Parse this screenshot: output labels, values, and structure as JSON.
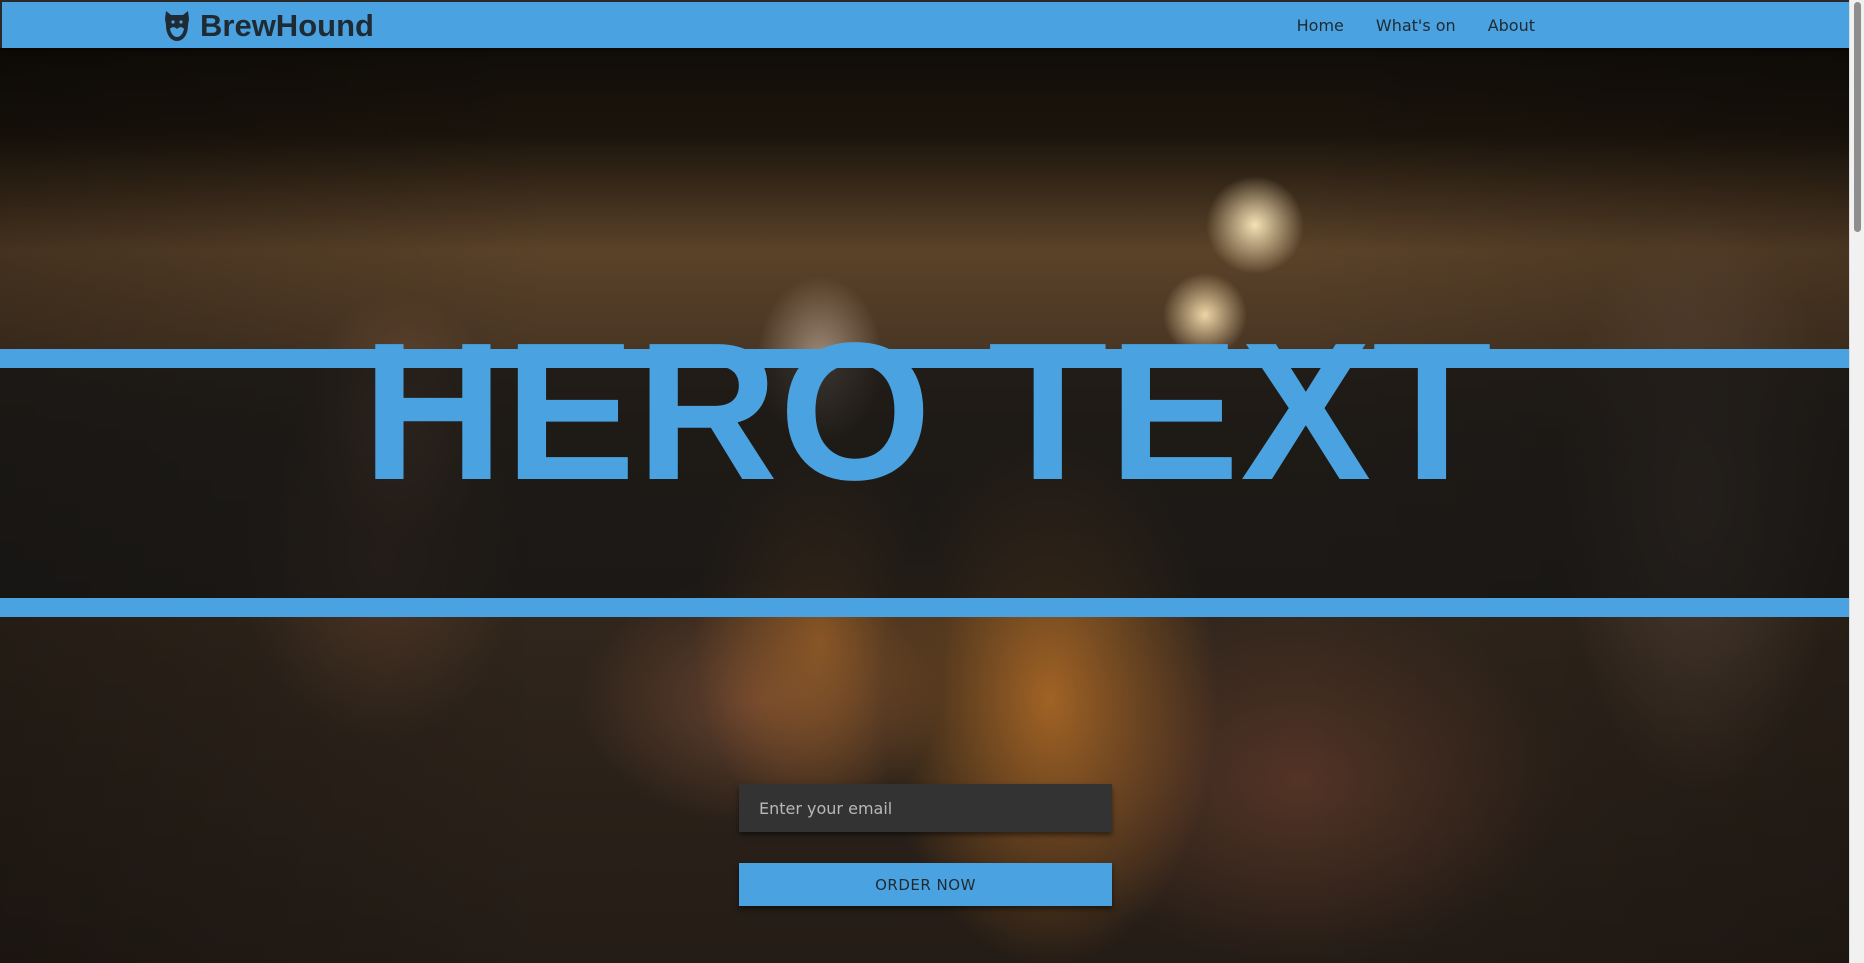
{
  "navbar": {
    "brand_name": "BrewHound",
    "brand_icon": "hound-logo-icon",
    "links": [
      {
        "label": "Home"
      },
      {
        "label": "What's on"
      },
      {
        "label": "About"
      }
    ]
  },
  "hero": {
    "headline": "HERO TEXT"
  },
  "form": {
    "email_placeholder": "Enter your email",
    "email_value": "",
    "submit_label": "ORDER NOW"
  },
  "colors": {
    "accent": "#4aa3e0",
    "text_dark": "#1f2a33",
    "input_bg": "#333333"
  }
}
